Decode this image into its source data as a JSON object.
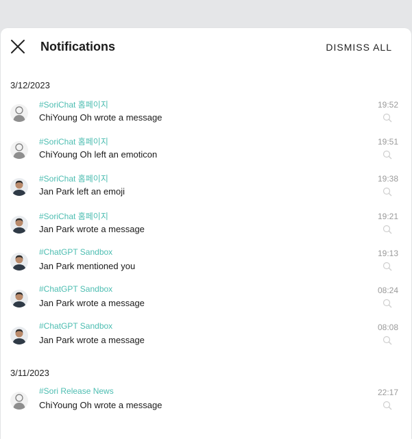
{
  "header": {
    "title": "Notifications",
    "dismiss_all": "DISMISS ALL"
  },
  "groups": [
    {
      "date": "3/12/2023",
      "items": [
        {
          "channel": "#SoriChat 홈페이지",
          "message": "ChiYoung Oh wrote a message",
          "time": "19:52",
          "avatar": "sketch-avatar"
        },
        {
          "channel": "#SoriChat 홈페이지",
          "message": "ChiYoung Oh left an emoticon",
          "time": "19:51",
          "avatar": "sketch-avatar"
        },
        {
          "channel": "#SoriChat 홈페이지",
          "message": "Jan Park left an emoji",
          "time": "19:38",
          "avatar": "photo-avatar"
        },
        {
          "channel": "#SoriChat 홈페이지",
          "message": "Jan Park wrote a message",
          "time": "19:21",
          "avatar": "photo-avatar"
        },
        {
          "channel": "#ChatGPT Sandbox",
          "message": "Jan Park mentioned you",
          "time": "19:13",
          "avatar": "photo-avatar"
        },
        {
          "channel": "#ChatGPT Sandbox",
          "message": "Jan Park wrote a message",
          "time": "08:24",
          "avatar": "photo-avatar"
        },
        {
          "channel": "#ChatGPT Sandbox",
          "message": "Jan Park wrote a message",
          "time": "08:08",
          "avatar": "photo-avatar"
        }
      ]
    },
    {
      "date": "3/11/2023",
      "items": [
        {
          "channel": "#Sori Release News",
          "message": "ChiYoung Oh wrote a message",
          "time": "22:17",
          "avatar": "sketch-avatar"
        }
      ]
    }
  ],
  "colors": {
    "accent": "#4cbdb1",
    "time": "#9a9a9a",
    "background": "#e5e6e8"
  },
  "icons": {
    "close": "close-icon",
    "item_action": "magnifier-icon"
  }
}
